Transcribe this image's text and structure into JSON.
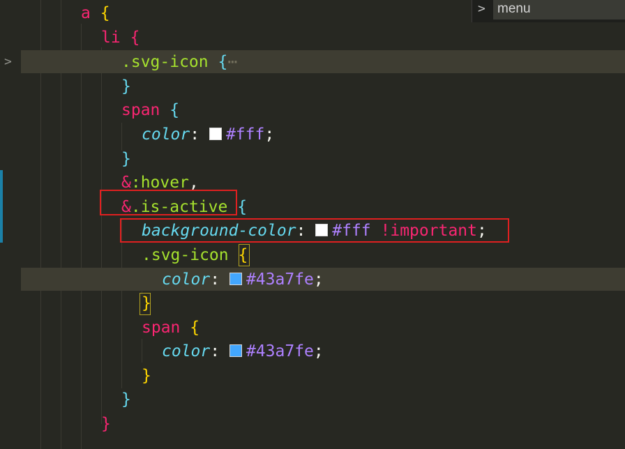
{
  "breadcrumb": {
    "chevron": ">",
    "label": "menu"
  },
  "gutter": {
    "fold_glyph": ">"
  },
  "lines": [
    {
      "tokens": [
        [
          "tag",
          "a"
        ],
        [
          "punc",
          " "
        ],
        [
          "brace-yellow",
          "{"
        ]
      ]
    },
    {
      "tokens": [
        [
          "tag",
          "li"
        ],
        [
          "punc",
          " "
        ],
        [
          "brace-pink",
          "{"
        ]
      ]
    },
    {
      "tokens": [
        [
          "cls",
          ".svg-icon"
        ],
        [
          "punc",
          " "
        ],
        [
          "brace-blue",
          "{"
        ],
        [
          "ellipsis",
          "⋯"
        ]
      ]
    },
    {
      "tokens": [
        [
          "brace-blue",
          "}"
        ]
      ]
    },
    {
      "tokens": [
        [
          "tag",
          "span"
        ],
        [
          "punc",
          " "
        ],
        [
          "brace-blue",
          "{"
        ]
      ]
    },
    {
      "tokens": [
        [
          "prop",
          "color"
        ],
        [
          "punc",
          ": "
        ],
        [
          "swatch",
          "#ffffff"
        ],
        [
          "num",
          "#fff"
        ],
        [
          "punc",
          ";"
        ]
      ]
    },
    {
      "tokens": [
        [
          "brace-blue",
          "}"
        ]
      ]
    },
    {
      "tokens": [
        [
          "tag",
          "&"
        ],
        [
          "cls",
          ":hover"
        ],
        [
          "punc",
          ","
        ]
      ]
    },
    {
      "tokens": [
        [
          "tag",
          "&"
        ],
        [
          "cls",
          ".is-active"
        ],
        [
          "punc",
          " "
        ],
        [
          "brace-blue",
          "{"
        ]
      ]
    },
    {
      "tokens": [
        [
          "prop",
          "background-color"
        ],
        [
          "punc",
          ": "
        ],
        [
          "swatch",
          "#ffffff"
        ],
        [
          "num",
          "#fff"
        ],
        [
          "punc",
          " "
        ],
        [
          "imp",
          "!important"
        ],
        [
          "punc",
          ";"
        ]
      ]
    },
    {
      "tokens": [
        [
          "cls",
          ".svg-icon"
        ],
        [
          "punc",
          " "
        ],
        [
          "brace-yellow",
          "{"
        ]
      ]
    },
    {
      "tokens": [
        [
          "prop",
          "color"
        ],
        [
          "punc",
          ": "
        ],
        [
          "swatch",
          "#43a7fe"
        ],
        [
          "num",
          "#43a7fe"
        ],
        [
          "punc",
          ";"
        ]
      ]
    },
    {
      "tokens": [
        [
          "brace-yellow",
          "}"
        ]
      ]
    },
    {
      "tokens": [
        [
          "tag",
          "span"
        ],
        [
          "punc",
          " "
        ],
        [
          "brace-yellow",
          "{"
        ]
      ]
    },
    {
      "tokens": [
        [
          "prop",
          "color"
        ],
        [
          "punc",
          ": "
        ],
        [
          "swatch",
          "#43a7fe"
        ],
        [
          "num",
          "#43a7fe"
        ],
        [
          "punc",
          ";"
        ]
      ]
    },
    {
      "tokens": [
        [
          "brace-yellow",
          "}"
        ]
      ]
    },
    {
      "tokens": [
        [
          "brace-blue",
          "}"
        ]
      ]
    },
    {
      "tokens": [
        [
          "brace-pink",
          "}"
        ]
      ]
    }
  ],
  "colors": {
    "background": "#272822",
    "annotation": "#e02020",
    "git_modified": "#1b81a8"
  }
}
